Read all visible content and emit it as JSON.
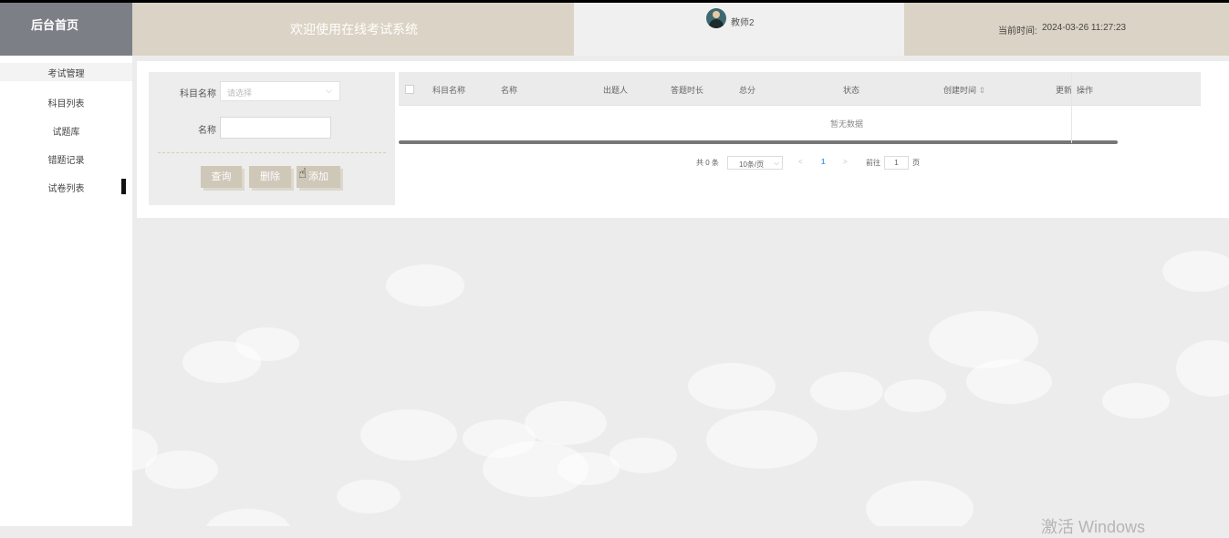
{
  "header": {
    "logo": "后台首页",
    "welcome": "欢迎使用在线考试系统",
    "username": "教师2",
    "time_label": "当前时间:",
    "time_value": "2024-03-26 11:27:23"
  },
  "sidebar": {
    "items": [
      {
        "label": "考试管理"
      },
      {
        "label": "科目列表"
      },
      {
        "label": "试题库"
      },
      {
        "label": "错题记录"
      },
      {
        "label": "试卷列表"
      }
    ]
  },
  "search_form": {
    "subject_label": "科目名称",
    "subject_placeholder": "请选择",
    "name_label": "名称",
    "name_value": "",
    "query_button": "查询",
    "delete_button": "删除",
    "add_button": "添加"
  },
  "table": {
    "columns": [
      "科目名称",
      "名称",
      "出题人",
      "答题时长",
      "总分",
      "状态",
      "创建时间",
      "更新",
      "操作"
    ],
    "sort_icon": "⇕",
    "empty_text": "暂无数据"
  },
  "pagination": {
    "total": "共 0 条",
    "page_size": "10条/页",
    "current_page": "1",
    "goto_label": "前往",
    "goto_value": "1",
    "page_unit": "页"
  },
  "watermark": "激活 Windows"
}
